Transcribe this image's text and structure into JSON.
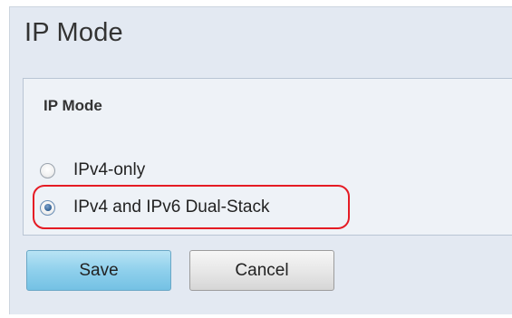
{
  "page": {
    "title": "IP Mode"
  },
  "panel": {
    "title": "IP Mode",
    "options": [
      {
        "label": "IPv4-only",
        "selected": false
      },
      {
        "label": "IPv4 and IPv6 Dual-Stack",
        "selected": true
      }
    ]
  },
  "buttons": {
    "save_label": "Save",
    "cancel_label": "Cancel"
  },
  "colors": {
    "background": "#e3e9f2",
    "panel_background": "#eef2f7",
    "save_button": "#8fd0ec",
    "highlight": "#e51b24"
  },
  "icons": {
    "radio_unselected": "radio-unchecked-icon",
    "radio_selected": "radio-checked-icon"
  }
}
